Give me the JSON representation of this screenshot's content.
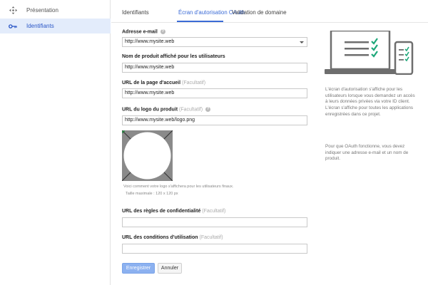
{
  "sidebar": {
    "items": [
      {
        "label": "Présentation",
        "icon": "move-icon",
        "active": false
      },
      {
        "label": "Identifiants",
        "icon": "key-icon",
        "active": true
      }
    ]
  },
  "tabs": [
    {
      "label": "Identifiants",
      "active": false
    },
    {
      "label": "Écran d'autorisation OAuth",
      "active": true
    },
    {
      "label": "Validation de domaine",
      "active": false
    }
  ],
  "form": {
    "email": {
      "label": "Adresse e-mail",
      "value": "http://www.mysite.web"
    },
    "product_name": {
      "label": "Nom de produit affiché pour les utilisateurs",
      "value": "http://www.mysite.web"
    },
    "homepage": {
      "label": "URL de la page d'accueil",
      "optional": "(Facultatif)",
      "value": "http://www.mysite.web"
    },
    "logo": {
      "label": "URL du logo du produit",
      "optional": "(Facultatif)",
      "value": "http://www.mysite.web/logo.png"
    },
    "logo_note": "Voici comment votre logo s'affichera pour les utilisateurs finaux.",
    "logo_size": "Taille maximale : 120 x 120 px",
    "privacy": {
      "label": "URL des règles de confidentialité",
      "optional": "(Facultatif)",
      "value": ""
    },
    "terms": {
      "label": "URL des conditions d'utilisation",
      "optional": "(Facultatif)",
      "value": ""
    }
  },
  "buttons": {
    "save": "Enregistrer",
    "cancel": "Annuler"
  },
  "panel": {
    "para1": "L'écran d'autorisation s'affiche pour les utilisateurs lorsque vous demandez un accès à leurs données privées via votre ID client. L'écran s'affiche pour toutes les applications enregistrées dans ce projet.",
    "para2": "Pour que OAuth fonctionne, vous devez indiquer une adresse e-mail et un nom de produit."
  },
  "colors": {
    "accent": "#3b6bd6",
    "sidebar_active_bg": "#e3ecfb",
    "check_green": "#1ea87a",
    "primary_button": "#8cb1f0"
  }
}
